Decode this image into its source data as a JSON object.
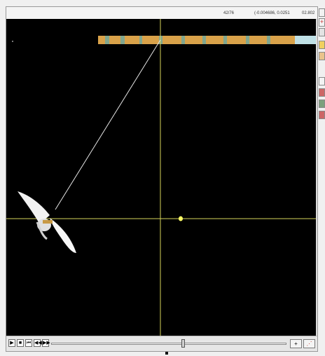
{
  "status_bar": {
    "frame_counter": "42/76",
    "cursor_coords": "(-0.004686, 0.0251",
    "time_value": "02.802"
  },
  "playback": {
    "play_label": "▶",
    "stop_label": "■",
    "step_back_label": "⏮",
    "rewind_label": "◀◀",
    "fast_forward_label": "▶▶",
    "position_fraction": 0.56
  },
  "tools": {
    "crosshair_tool_label": "+",
    "scatter_tool_label": "⋰"
  },
  "colors": {
    "canvas_background": "#000000",
    "crosshair": "#d6d35a",
    "tracer_line": "#e6e6e6",
    "cursor_marker": "#ffff66",
    "strip_primary": "#d9a24a",
    "strip_secondary": "#6aa9a0"
  },
  "icons": {
    "right_toolbar": [
      "square-icon",
      "plus-icon",
      "grid-icon",
      "ruler-icon",
      "note-icon",
      "chart-icon",
      "bar-icon",
      "stripe-icon",
      "stripe-icon"
    ]
  }
}
